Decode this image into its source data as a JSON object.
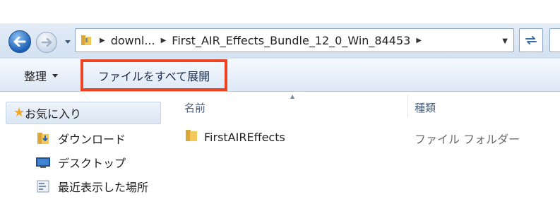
{
  "address": {
    "crumbs": [
      "downl...",
      "First_AIR_Effects_Bundle_12_0_Win_84453"
    ]
  },
  "toolbar": {
    "organize_label": "整理",
    "extract_all_label": "ファイルをすべて展開"
  },
  "nav": {
    "favorites_label": "お気に入り",
    "items": [
      {
        "label": "ダウンロード",
        "icon": "download-folder-icon"
      },
      {
        "label": "デスクトップ",
        "icon": "desktop-icon"
      },
      {
        "label": "最近表示した場所",
        "icon": "recent-places-icon"
      }
    ]
  },
  "list": {
    "columns": [
      "名前",
      "種類"
    ],
    "rows": [
      {
        "name": "FirstAIREffects",
        "type": "ファイル フォルダー"
      }
    ]
  },
  "colors": {
    "highlight_border": "#ee4322",
    "folder": "#e8b84a"
  }
}
